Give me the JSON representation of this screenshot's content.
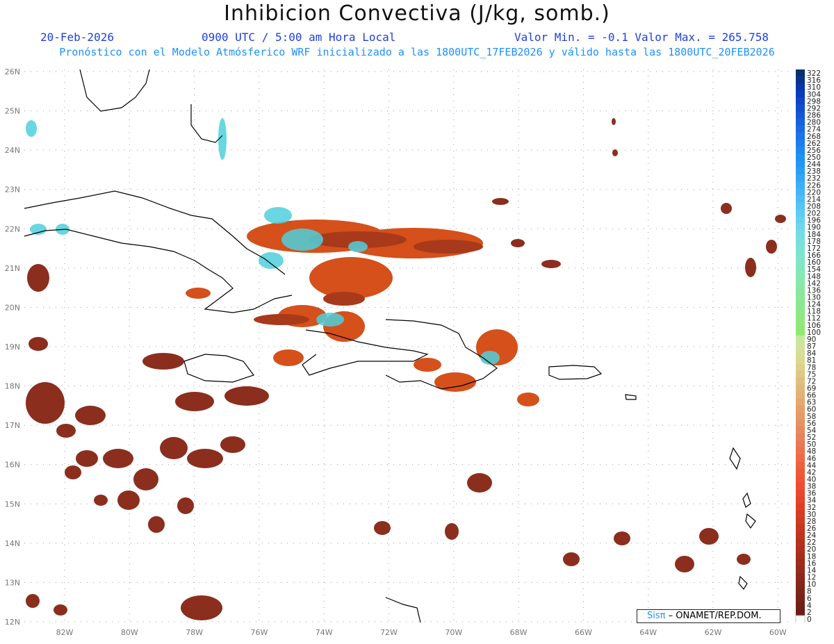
{
  "header": {
    "title": "Inhibicion Convectiva (J/kg, somb.)",
    "date": "20-Feb-2026",
    "time": "0900 UTC / 5:00 am Hora Local",
    "minmax": "Valor Min. = -0.1  Valor Max. = 265.758",
    "info_line": "Pronóstico con el Modelo Atmósferico WRF inicializado a las 1800UTC_17FEB2026 y válido hasta las  1800UTC_20FEB2026"
  },
  "map": {
    "lat_labels": [
      "26N",
      "25N",
      "24N",
      "23N",
      "22N",
      "21N",
      "20N",
      "19N",
      "18N",
      "17N",
      "16N",
      "15N",
      "14N",
      "13N",
      "12N"
    ],
    "lon_labels": [
      "82W",
      "80W",
      "78W",
      "76W",
      "74W",
      "72W",
      "70W",
      "68W",
      "66W",
      "64W",
      "62W",
      "60W"
    ],
    "grid": true,
    "colors": {
      "land_outline": "#000000",
      "grid": "#9a9a9a",
      "cin_low": "#8b2e1e",
      "cin_mid": "#e85a10",
      "cin_high": "#4fd0dc"
    }
  },
  "credit": {
    "logo": "Sisπ",
    "text": "– ONAMET/REP.DOM."
  },
  "colorbar": {
    "labels": [
      "322",
      "316",
      "310",
      "304",
      "298",
      "292",
      "286",
      "280",
      "274",
      "268",
      "262",
      "256",
      "250",
      "244",
      "238",
      "232",
      "226",
      "220",
      "214",
      "208",
      "202",
      "196",
      "190",
      "184",
      "178",
      "172",
      "166",
      "160",
      "154",
      "148",
      "142",
      "136",
      "130",
      "124",
      "118",
      "112",
      "106",
      "100",
      "90",
      "87",
      "84",
      "81",
      "78",
      "75",
      "72",
      "69",
      "66",
      "63",
      "60",
      "58",
      "56",
      "54",
      "52",
      "50",
      "48",
      "46",
      "44",
      "42",
      "40",
      "38",
      "36",
      "34",
      "32",
      "30",
      "28",
      "26",
      "24",
      "22",
      "20",
      "18",
      "16",
      "14",
      "12",
      "10",
      "8",
      "6",
      "4",
      "2",
      "0"
    ],
    "colors": [
      "#08306b",
      "#08318f",
      "#0835a8",
      "#0b3cb8",
      "#0f45c4",
      "#124ecc",
      "#1457d4",
      "#1760dc",
      "#196ae2",
      "#1a74e8",
      "#1b7eec",
      "#1c88ef",
      "#1e92f2",
      "#2196f3",
      "#2a9ef5",
      "#33a6f6",
      "#3caef7",
      "#45b5f7",
      "#4dbdf7",
      "#56c4f5",
      "#5ecbf2",
      "#66d2ee",
      "#6ed7e9",
      "#74dce3",
      "#78e0dc",
      "#7be3d5",
      "#7ee5cd",
      "#80e6c4",
      "#82e7bb",
      "#84e8b2",
      "#86e8a9",
      "#88e8a0",
      "#8ae898",
      "#8be890",
      "#8de888",
      "#8fe880",
      "#91e878",
      "#93e870",
      "#c8e8a0",
      "#d0e4a0",
      "#d6de98",
      "#dcd890",
      "#ddd08a",
      "#dfc885",
      "#e0c07f",
      "#e1b87a",
      "#e3b075",
      "#e4a870",
      "#e5a06a",
      "#e69a66",
      "#e79262",
      "#e88a5c",
      "#e98256",
      "#ea7a50",
      "#eb724a",
      "#ec6a44",
      "#ed623e",
      "#ee5a38",
      "#ef5434",
      "#ee4e30",
      "#ea482c",
      "#e44428",
      "#de4026",
      "#d63c24",
      "#ce3a22",
      "#c63620",
      "#be341f",
      "#b6321e",
      "#ae301e",
      "#a62e1d",
      "#9e2c1c",
      "#962a1c",
      "#8e281b",
      "#86261a",
      "#80241a",
      "#7a2219",
      "#742018",
      "#6e1e18",
      "#ffffff"
    ]
  }
}
